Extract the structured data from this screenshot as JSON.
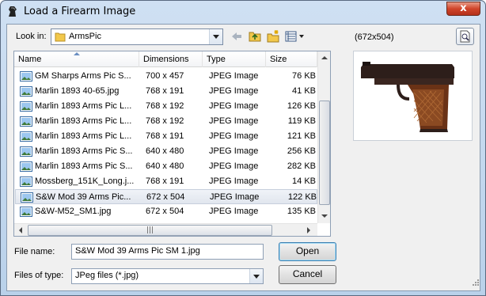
{
  "window": {
    "title": "Load a Firearm Image",
    "close_glyph": "x"
  },
  "lookin": {
    "label": "Look in:",
    "value": "ArmsPic"
  },
  "toolbar": {
    "back_icon": "back-arrow-icon",
    "up_icon": "up-folder-icon",
    "new_icon": "new-folder-icon",
    "view_icon": "view-menu-icon"
  },
  "columns": {
    "name": "Name",
    "dimensions": "Dimensions",
    "type": "Type",
    "size": "Size"
  },
  "files": [
    {
      "name": "GM Sharps Arms Pic S...",
      "dimensions": "700 x 457",
      "type": "JPEG Image",
      "size": "76 KB"
    },
    {
      "name": "Marlin 1893 40-65.jpg",
      "dimensions": "768 x 191",
      "type": "JPEG Image",
      "size": "41 KB"
    },
    {
      "name": "Marlin 1893 Arms Pic L...",
      "dimensions": "768 x 192",
      "type": "JPEG Image",
      "size": "126 KB"
    },
    {
      "name": "Marlin 1893 Arms Pic L...",
      "dimensions": "768 x 192",
      "type": "JPEG Image",
      "size": "119 KB"
    },
    {
      "name": "Marlin 1893 Arms Pic L...",
      "dimensions": "768 x 191",
      "type": "JPEG Image",
      "size": "121 KB"
    },
    {
      "name": "Marlin 1893 Arms Pic S...",
      "dimensions": "640 x 480",
      "type": "JPEG Image",
      "size": "256 KB"
    },
    {
      "name": "Marlin 1893 Arms Pic S...",
      "dimensions": "640 x 480",
      "type": "JPEG Image",
      "size": "282 KB"
    },
    {
      "name": "Mossberg_151K_Long.j...",
      "dimensions": "768 x 191",
      "type": "JPEG Image",
      "size": "14 KB"
    },
    {
      "name": "S&W Mod 39 Arms Pic...",
      "dimensions": "672 x 504",
      "type": "JPEG Image",
      "size": "122 KB"
    },
    {
      "name": "S&W-M52_SM1.jpg",
      "dimensions": "672 x 504",
      "type": "JPEG Image",
      "size": "135 KB"
    }
  ],
  "selected_index": 8,
  "preview": {
    "dimensions": "(672x504)"
  },
  "filename": {
    "label": "File name:",
    "value": "S&W Mod 39 Arms Pic SM 1.jpg"
  },
  "filetype": {
    "label": "Files of type:",
    "value": "JPeg files (*.jpg)"
  },
  "buttons": {
    "open": "Open",
    "cancel": "Cancel"
  },
  "colors": {
    "selection": "#e1e6ee",
    "title_bar": "#c4d8ee",
    "close": "#d0452a"
  }
}
